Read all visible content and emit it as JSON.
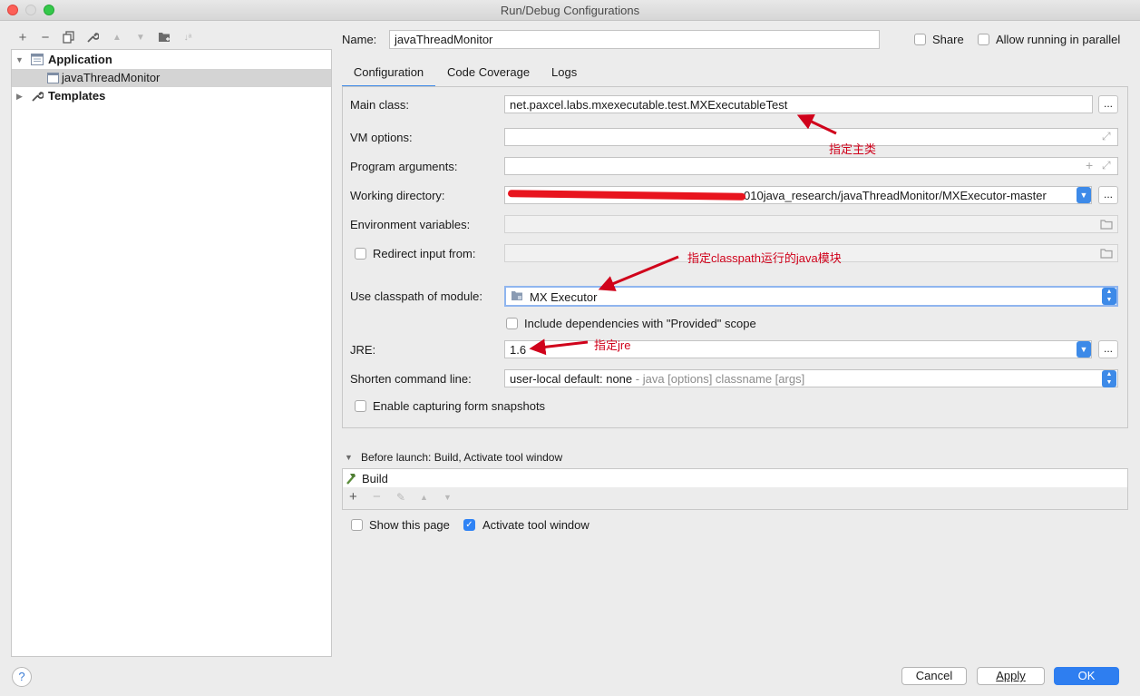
{
  "window": {
    "title": "Run/Debug Configurations"
  },
  "tree": {
    "application_label": "Application",
    "config_item": "javaThreadMonitor",
    "templates_label": "Templates"
  },
  "header": {
    "name_label": "Name:",
    "name_value": "javaThreadMonitor",
    "share_label": "Share",
    "parallel_label": "Allow running in parallel"
  },
  "tabs": [
    "Configuration",
    "Code Coverage",
    "Logs"
  ],
  "form": {
    "main_class_label": "Main class:",
    "main_class_value": "net.paxcel.labs.mxexecutable.test.MXExecutableTest",
    "vm_options_label": "VM options:",
    "program_args_label": "Program arguments:",
    "working_dir_label": "Working directory:",
    "working_dir_value": "010java_research/javaThreadMonitor/MXExecutor-master",
    "env_vars_label": "Environment variables:",
    "redirect_label": "Redirect input from:",
    "classpath_label": "Use classpath of module:",
    "classpath_value": "MX Executor",
    "include_deps_label": "Include dependencies with \"Provided\" scope",
    "jre_label": "JRE:",
    "jre_value": "1.6",
    "shorten_label": "Shorten command line:",
    "shorten_value": "user-local default: none",
    "shorten_hint": " - java [options] classname [args]",
    "snapshots_label": "Enable capturing form snapshots",
    "dots": "..."
  },
  "annotations": {
    "main_class": "指定主类",
    "classpath": "指定classpath运行的java模块",
    "jre": "指定jre"
  },
  "before_launch": {
    "header": "Before launch: Build, Activate tool window",
    "build_item": "Build"
  },
  "options": {
    "show_page_label": "Show this page",
    "activate_label": "Activate tool window"
  },
  "buttons": {
    "cancel": "Cancel",
    "apply": "Apply",
    "ok": "OK",
    "help": "?"
  },
  "colors": {
    "accent": "#2e7ef0",
    "annotation": "#d0021b",
    "redaction": "#e8141e"
  }
}
